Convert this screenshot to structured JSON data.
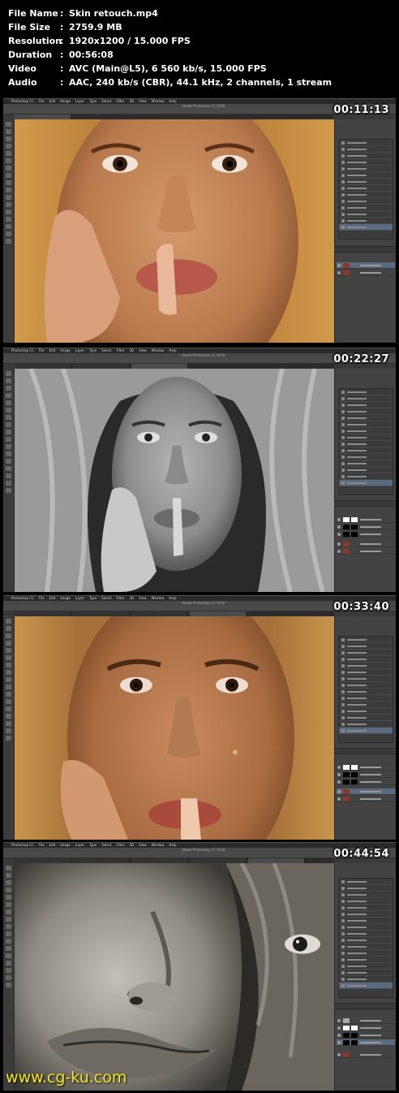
{
  "info": {
    "rows": [
      {
        "label": "File Name",
        "sep": ":",
        "value": "Skin retouch.mp4"
      },
      {
        "label": "File Size",
        "sep": ":",
        "value": "2759.9 MB"
      },
      {
        "label": "Resolution",
        "sep": ":",
        "value": "1920x1200 / 15.000 FPS"
      },
      {
        "label": "Duration",
        "sep": ":",
        "value": "00:56:08"
      },
      {
        "label": "Video",
        "sep": ":",
        "value": "AVC (Main@L5), 6 560 kb/s, 15.000 FPS"
      },
      {
        "label": "Audio",
        "sep": ":",
        "value": "AAC, 240 kb/s (CBR), 44.1 kHz, 2 channels, 1 stream"
      }
    ]
  },
  "frames": [
    {
      "timestamp": "00:11:13",
      "app_title": "Adobe Photoshop CC 2018",
      "mode": "color"
    },
    {
      "timestamp": "00:22:27",
      "app_title": "Adobe Photoshop CC 2018",
      "mode": "bw"
    },
    {
      "timestamp": "00:33:40",
      "app_title": "Adobe Photoshop CC 2018",
      "mode": "color"
    },
    {
      "timestamp": "00:44:54",
      "app_title": "Adobe Photoshop CC 2018",
      "mode": "bw-closeup"
    }
  ],
  "menu": [
    "Photoshop CC",
    "File",
    "Edit",
    "Image",
    "Layer",
    "Type",
    "Select",
    "Filter",
    "3D",
    "View",
    "Window",
    "Help"
  ],
  "watermark": "www.cg-ku.com",
  "colors": {
    "skin": "#c98a5e",
    "hair": "#c1863f",
    "bg_warm": "#b27d45",
    "ui_dark": "#3a3a3a",
    "timestamp": "#ffffff",
    "watermark": "#f3e91f"
  }
}
